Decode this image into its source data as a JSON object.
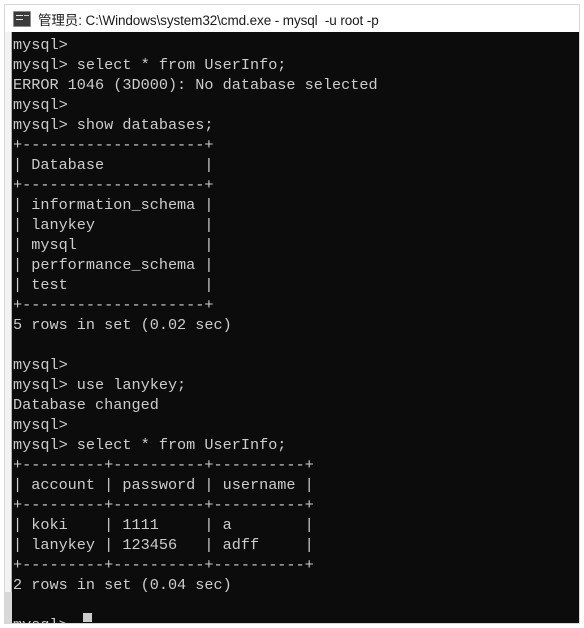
{
  "window": {
    "title": "管理员: C:\\Windows\\system32\\cmd.exe - mysql  -u root -p",
    "icon": "cmd-console-icon",
    "background_color": "#0c0c0c",
    "text_color": "#cccccc",
    "titlebar_background": "#ffffff"
  },
  "terminal": {
    "lines": [
      "mysql>",
      "mysql> select * from UserInfo;",
      "ERROR 1046 (3D000): No database selected",
      "mysql>",
      "mysql> show databases;",
      "+--------------------+",
      "| Database           |",
      "+--------------------+",
      "| information_schema |",
      "| lanykey            |",
      "| mysql              |",
      "| performance_schema |",
      "| test               |",
      "+--------------------+",
      "5 rows in set (0.02 sec)",
      "",
      "mysql>",
      "mysql> use lanykey;",
      "Database changed",
      "mysql>",
      "mysql> select * from UserInfo;",
      "+---------+----------+----------+",
      "| account | password | username |",
      "+---------+----------+----------+",
      "| koki    | 1111     | a        |",
      "| lanykey | 123456   | adff     |",
      "+---------+----------+----------+",
      "2 rows in set (0.04 sec)",
      "",
      "mysql>"
    ],
    "cursor": "block"
  },
  "commands": [
    "select * from UserInfo;",
    "show databases;",
    "use lanykey;",
    "select * from UserInfo;"
  ],
  "errors": [
    "ERROR 1046 (3D000): No database selected"
  ],
  "status_messages": [
    "5 rows in set (0.02 sec)",
    "Database changed",
    "2 rows in set (0.04 sec)"
  ],
  "databases_table": {
    "columns": [
      "Database"
    ],
    "rows": [
      [
        "information_schema"
      ],
      [
        "lanykey"
      ],
      [
        "mysql"
      ],
      [
        "performance_schema"
      ],
      [
        "test"
      ]
    ],
    "row_count_text": "5 rows in set (0.02 sec)"
  },
  "userinfo_table": {
    "columns": [
      "account",
      "password",
      "username"
    ],
    "rows": [
      [
        "koki",
        "1111",
        "a"
      ],
      [
        "lanykey",
        "123456",
        "adff"
      ]
    ],
    "row_count_text": "2 rows in set (0.04 sec)"
  },
  "prompt": "mysql>"
}
